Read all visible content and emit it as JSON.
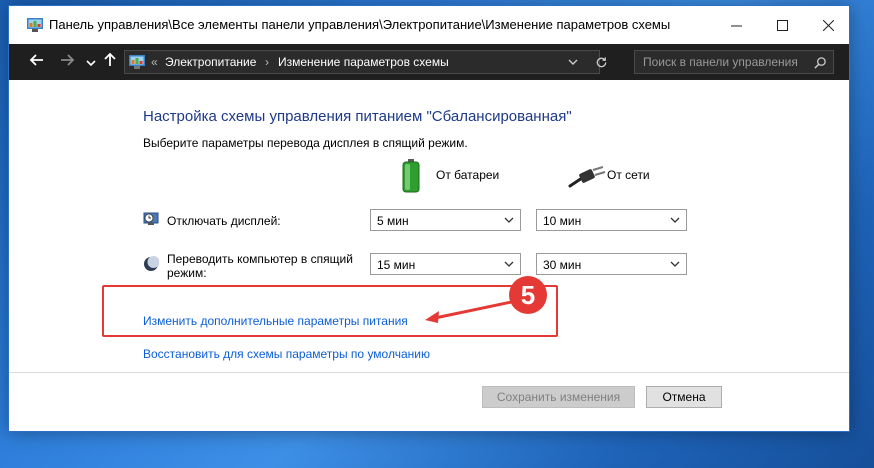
{
  "window": {
    "title": "Панель управления\\Все элементы панели управления\\Электропитание\\Изменение параметров схемы"
  },
  "navigation": {
    "back_icon": "arrow-left-icon",
    "forward_icon": "arrow-right-icon",
    "recent_icon": "chevron-down-icon",
    "up_icon": "arrow-up-icon",
    "address": {
      "overflow": "«",
      "crumb_1": "Электропитание",
      "separator": "›",
      "crumb_2": "Изменение параметров схемы"
    },
    "search_placeholder": "Поиск в панели управления"
  },
  "content": {
    "heading": "Настройка схемы управления питанием \"Сбалансированная\"",
    "subtext": "Выберите параметры перевода дисплея в спящий режим.",
    "columns": {
      "battery": "От батареи",
      "ac": "От сети"
    },
    "rows": [
      {
        "label": "Отключать дисплей:",
        "battery_value": "5 мин",
        "ac_value": "10 мин"
      },
      {
        "label": "Переводить компьютер в спящий режим:",
        "battery_value": "15 мин",
        "ac_value": "30 мин"
      }
    ],
    "link_advanced": "Изменить дополнительные параметры питания",
    "link_restore": "Восстановить для схемы параметры по умолчанию",
    "annotation_number": "5"
  },
  "buttons": {
    "save": "Сохранить изменения",
    "cancel": "Отмена"
  },
  "colors": {
    "accent_link": "#0b5ed7",
    "heading": "#1e3a8a",
    "annotation_red": "#e53935",
    "navbar_bg": "#1f1f1f"
  }
}
